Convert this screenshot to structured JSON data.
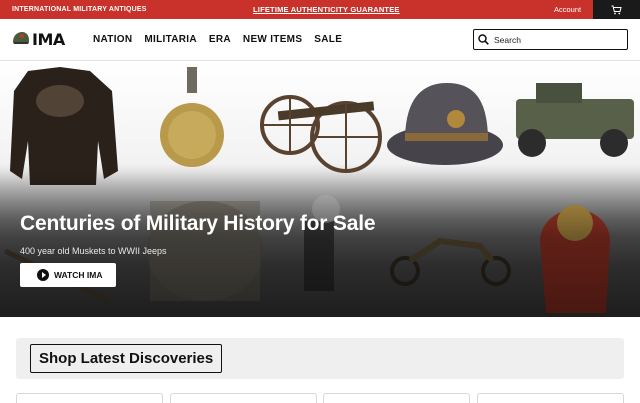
{
  "topbar": {
    "left_text": "INTERNATIONAL MILITARY ANTIQUES",
    "promo_link": "LIFETIME AUTHENTICITY GUARANTEE",
    "account_label": "Account",
    "cart_icon": "cart-icon"
  },
  "header": {
    "logo_text": "IMA",
    "nav": [
      "NATION",
      "MILITARIA",
      "ERA",
      "NEW ITEMS",
      "SALE"
    ],
    "search_placeholder": "Search"
  },
  "hero": {
    "title": "Centuries of Military History for Sale",
    "subtitle": "400 year old Muskets to WWII Jeeps",
    "button_label": "WATCH IMA"
  },
  "section": {
    "title": "Shop Latest Discoveries"
  },
  "colors": {
    "accent": "#c8322a",
    "dark": "#1a1a1a"
  }
}
